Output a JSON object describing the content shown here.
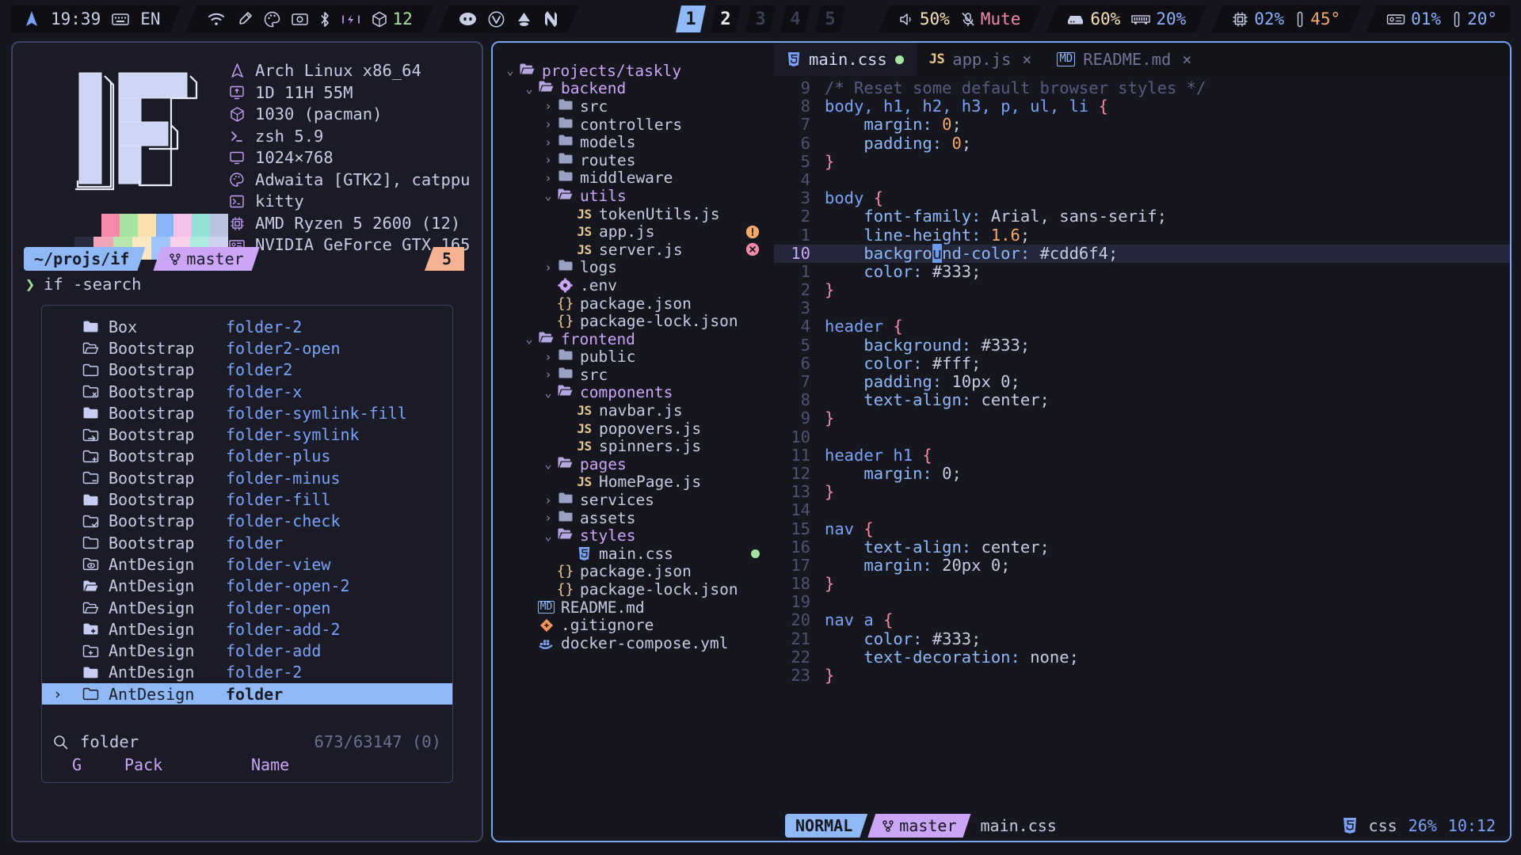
{
  "topbar": {
    "groups": [
      {
        "name": "system",
        "items": [
          {
            "icon": "arch-logo-icon",
            "text": ""
          },
          {
            "icon": "",
            "text": "19:39"
          },
          {
            "icon": "keyboard-icon",
            "text": "EN"
          }
        ]
      },
      {
        "name": "tray",
        "items": [
          {
            "icon": "wifi-icon",
            "text": ""
          },
          {
            "icon": "eyedropper-icon",
            "text": ""
          },
          {
            "icon": "palette-icon",
            "text": ""
          },
          {
            "icon": "camera-icon",
            "text": ""
          },
          {
            "icon": "bluetooth-icon",
            "text": ""
          },
          {
            "icon": "power-icon",
            "text": ""
          },
          {
            "icon": "package-icon",
            "text": "12",
            "color": "#a6e3a1"
          }
        ]
      },
      {
        "name": "apps",
        "items": [
          {
            "icon": "discord-icon",
            "text": ""
          },
          {
            "icon": "vivaldi-icon",
            "text": ""
          },
          {
            "icon": "inkscape-icon",
            "text": ""
          },
          {
            "icon": "neovim-icon",
            "text": ""
          }
        ]
      }
    ],
    "workspaces": [
      {
        "label": "1",
        "state": "active"
      },
      {
        "label": "2",
        "state": "occupied"
      },
      {
        "label": "3",
        "state": "empty"
      },
      {
        "label": "4",
        "state": "empty"
      },
      {
        "label": "5",
        "state": "empty"
      }
    ],
    "audio": {
      "volume_icon": "speaker-icon",
      "volume": "50%",
      "mic_icon": "mic-muted-icon",
      "mic_label": "Mute"
    },
    "storage": {
      "disk_icon": "disk-icon",
      "disk": "60%",
      "ram_icon": "ram-icon",
      "ram": "20%"
    },
    "cpu": {
      "cpu_icon": "cpu-icon",
      "load": "02%",
      "temp_icon": "thermometer-icon",
      "temp": "45°"
    },
    "gpu": {
      "gpu_icon": "gpu-icon",
      "load": "01%",
      "temp_icon": "thermometer-icon",
      "temp": "20°"
    }
  },
  "fetch": {
    "info": [
      {
        "icon": "arch-icon",
        "text": "Arch Linux x86_64"
      },
      {
        "icon": "uptime-icon",
        "text": "1D 11H 55M"
      },
      {
        "icon": "packages-icon",
        "text": "1030 (pacman)"
      },
      {
        "icon": "shell-icon",
        "text": "zsh 5.9"
      },
      {
        "icon": "display-icon",
        "text": "1024×768"
      },
      {
        "icon": "theme-icon",
        "text": "Adwaita [GTK2], catppu"
      },
      {
        "icon": "terminal-icon",
        "text": "kitty"
      },
      {
        "icon": "cpu-icon",
        "text": "AMD Ryzen 5 2600 (12)"
      },
      {
        "icon": "gpu-icon",
        "text": "NVIDIA GeForce GTX 165"
      }
    ],
    "palette_row1": [
      "#f38ba8",
      "#a6e3a1",
      "#f9e2af",
      "#89b4fa",
      "#f5c2e7",
      "#94e2d5",
      "#bac2de"
    ],
    "palette_row2": [
      "#f2a4b8",
      "#b9e6ae",
      "#fae8c0",
      "#9ec4fb",
      "#f8d0ec",
      "#aeeade",
      "#ccd2ee"
    ],
    "palette_dark": "#2a2b3c"
  },
  "prompt": {
    "path": "~/projs/if",
    "git_icon": "git-branch-icon",
    "git_branch": "master",
    "badge": "5",
    "chevron": "❯",
    "command": "if -search"
  },
  "fzf": {
    "query_icon": "search-icon",
    "query": "folder",
    "count": "673/63147 (0)",
    "headers": {
      "g": "G",
      "pack": "Pack",
      "name": "Name"
    },
    "rows": [
      {
        "icon": "folder-fill-icon",
        "pack": "Box",
        "name": "folder-2",
        "selected": false
      },
      {
        "icon": "folder-open-outline-icon",
        "pack": "Bootstrap",
        "name": "folder2-open",
        "selected": false
      },
      {
        "icon": "folder-outline-icon",
        "pack": "Bootstrap",
        "name": "folder2",
        "selected": false
      },
      {
        "icon": "folder-x-icon",
        "pack": "Bootstrap",
        "name": "folder-x",
        "selected": false
      },
      {
        "icon": "folder-fill-icon",
        "pack": "Bootstrap",
        "name": "folder-symlink-fill",
        "selected": false
      },
      {
        "icon": "folder-symlink-icon",
        "pack": "Bootstrap",
        "name": "folder-symlink",
        "selected": false
      },
      {
        "icon": "folder-plus-icon",
        "pack": "Bootstrap",
        "name": "folder-plus",
        "selected": false
      },
      {
        "icon": "folder-minus-icon",
        "pack": "Bootstrap",
        "name": "folder-minus",
        "selected": false
      },
      {
        "icon": "folder-fill-icon",
        "pack": "Bootstrap",
        "name": "folder-fill",
        "selected": false
      },
      {
        "icon": "folder-check-icon",
        "pack": "Bootstrap",
        "name": "folder-check",
        "selected": false
      },
      {
        "icon": "folder-outline-icon",
        "pack": "Bootstrap",
        "name": "folder",
        "selected": false
      },
      {
        "icon": "folder-view-icon",
        "pack": "AntDesign",
        "name": "folder-view",
        "selected": false
      },
      {
        "icon": "folder-open-fill-icon",
        "pack": "AntDesign",
        "name": "folder-open-2",
        "selected": false
      },
      {
        "icon": "folder-open-outline-icon",
        "pack": "AntDesign",
        "name": "folder-open",
        "selected": false
      },
      {
        "icon": "folder-add-fill-icon",
        "pack": "AntDesign",
        "name": "folder-add-2",
        "selected": false
      },
      {
        "icon": "folder-add-icon",
        "pack": "AntDesign",
        "name": "folder-add",
        "selected": false
      },
      {
        "icon": "folder-fill-icon",
        "pack": "AntDesign",
        "name": "folder-2",
        "selected": false
      },
      {
        "icon": "folder-outline-icon",
        "pack": "AntDesign",
        "name": "folder",
        "selected": true
      }
    ]
  },
  "tree": [
    {
      "depth": 0,
      "arrow": "⌄",
      "icon": "folder-open-icon",
      "label": "projects/taskly",
      "kind": "dir-open"
    },
    {
      "depth": 1,
      "arrow": "⌄",
      "icon": "folder-open-icon",
      "label": "backend",
      "kind": "dir-open"
    },
    {
      "depth": 2,
      "arrow": "›",
      "icon": "folder-icon",
      "label": "src",
      "kind": "dir"
    },
    {
      "depth": 2,
      "arrow": "›",
      "icon": "folder-icon",
      "label": "controllers",
      "kind": "dir"
    },
    {
      "depth": 2,
      "arrow": "›",
      "icon": "folder-icon",
      "label": "models",
      "kind": "dir"
    },
    {
      "depth": 2,
      "arrow": "›",
      "icon": "folder-icon",
      "label": "routes",
      "kind": "dir"
    },
    {
      "depth": 2,
      "arrow": "›",
      "icon": "folder-icon",
      "label": "middleware",
      "kind": "dir"
    },
    {
      "depth": 2,
      "arrow": "⌄",
      "icon": "folder-open-icon",
      "label": "utils",
      "kind": "dir-open"
    },
    {
      "depth": 3,
      "arrow": "",
      "icon": "js-icon",
      "label": "tokenUtils.js",
      "kind": "file"
    },
    {
      "depth": 3,
      "arrow": "",
      "icon": "js-icon",
      "label": "app.js",
      "kind": "file",
      "diag": "warning"
    },
    {
      "depth": 3,
      "arrow": "",
      "icon": "js-icon",
      "label": "server.js",
      "kind": "file",
      "diag": "error"
    },
    {
      "depth": 2,
      "arrow": "›",
      "icon": "folder-icon",
      "label": "logs",
      "kind": "dir"
    },
    {
      "depth": 2,
      "arrow": "",
      "icon": "gear-icon",
      "label": ".env",
      "kind": "file"
    },
    {
      "depth": 2,
      "arrow": "",
      "icon": "json-icon",
      "label": "package.json",
      "kind": "file"
    },
    {
      "depth": 2,
      "arrow": "",
      "icon": "json-icon",
      "label": "package-lock.json",
      "kind": "file"
    },
    {
      "depth": 1,
      "arrow": "⌄",
      "icon": "folder-open-icon",
      "label": "frontend",
      "kind": "dir-open"
    },
    {
      "depth": 2,
      "arrow": "›",
      "icon": "folder-icon",
      "label": "public",
      "kind": "dir"
    },
    {
      "depth": 2,
      "arrow": "›",
      "icon": "folder-icon",
      "label": "src",
      "kind": "dir"
    },
    {
      "depth": 2,
      "arrow": "⌄",
      "icon": "folder-open-icon",
      "label": "components",
      "kind": "dir-open"
    },
    {
      "depth": 3,
      "arrow": "",
      "icon": "js-icon",
      "label": "navbar.js",
      "kind": "file"
    },
    {
      "depth": 3,
      "arrow": "",
      "icon": "js-icon",
      "label": "popovers.js",
      "kind": "file"
    },
    {
      "depth": 3,
      "arrow": "",
      "icon": "js-icon",
      "label": "spinners.js",
      "kind": "file"
    },
    {
      "depth": 2,
      "arrow": "⌄",
      "icon": "folder-open-icon",
      "label": "pages",
      "kind": "dir-open"
    },
    {
      "depth": 3,
      "arrow": "",
      "icon": "js-icon",
      "label": "HomePage.js",
      "kind": "file"
    },
    {
      "depth": 2,
      "arrow": "›",
      "icon": "folder-icon",
      "label": "services",
      "kind": "dir"
    },
    {
      "depth": 2,
      "arrow": "›",
      "icon": "folder-icon",
      "label": "assets",
      "kind": "dir"
    },
    {
      "depth": 2,
      "arrow": "⌄",
      "icon": "folder-open-icon",
      "label": "styles",
      "kind": "dir-open"
    },
    {
      "depth": 3,
      "arrow": "",
      "icon": "css-icon",
      "label": "main.css",
      "kind": "file",
      "diag": "modified"
    },
    {
      "depth": 2,
      "arrow": "",
      "icon": "json-icon",
      "label": "package.json",
      "kind": "file"
    },
    {
      "depth": 2,
      "arrow": "",
      "icon": "json-icon",
      "label": "package-lock.json",
      "kind": "file"
    },
    {
      "depth": 1,
      "arrow": "",
      "icon": "md-icon",
      "label": "README.md",
      "kind": "file"
    },
    {
      "depth": 1,
      "arrow": "",
      "icon": "git-icon",
      "label": ".gitignore",
      "kind": "file"
    },
    {
      "depth": 1,
      "arrow": "",
      "icon": "docker-icon",
      "label": "docker-compose.yml",
      "kind": "file"
    }
  ],
  "tabs": [
    {
      "icon": "css-icon",
      "label": "main.css",
      "active": true,
      "modified": true,
      "closable": false
    },
    {
      "icon": "js-icon",
      "label": "app.js",
      "active": false,
      "modified": false,
      "closable": true
    },
    {
      "icon": "md-icon",
      "label": "README.md",
      "active": false,
      "modified": false,
      "closable": true
    }
  ],
  "code": {
    "lines": [
      {
        "num": "9",
        "cur": false,
        "tokens": [
          {
            "t": "/* Reset some default browser styles */",
            "c": "k-com"
          }
        ]
      },
      {
        "num": "8",
        "cur": false,
        "tokens": [
          {
            "t": "body, h1, h2, h3, p, ul, li ",
            "c": "k-sel"
          },
          {
            "t": "{",
            "c": "k-brace"
          }
        ]
      },
      {
        "num": "7",
        "cur": false,
        "tokens": [
          {
            "t": "    ",
            "c": "k-guide"
          },
          {
            "t": "margin: ",
            "c": "k-prop"
          },
          {
            "t": "0",
            "c": "k-num"
          },
          {
            "t": ";",
            "c": "k-val"
          }
        ]
      },
      {
        "num": "6",
        "cur": false,
        "tokens": [
          {
            "t": "    ",
            "c": "k-guide"
          },
          {
            "t": "padding: ",
            "c": "k-prop"
          },
          {
            "t": "0",
            "c": "k-num"
          },
          {
            "t": ";",
            "c": "k-val"
          }
        ]
      },
      {
        "num": "5",
        "cur": false,
        "tokens": [
          {
            "t": "}",
            "c": "k-brace"
          }
        ]
      },
      {
        "num": "4",
        "cur": false,
        "tokens": []
      },
      {
        "num": "3",
        "cur": false,
        "tokens": [
          {
            "t": "body ",
            "c": "k-sel"
          },
          {
            "t": "{",
            "c": "k-brace"
          }
        ]
      },
      {
        "num": "2",
        "cur": false,
        "tokens": [
          {
            "t": "    ",
            "c": "k-guide"
          },
          {
            "t": "font-family: ",
            "c": "k-prop"
          },
          {
            "t": "Arial, sans-serif;",
            "c": "k-val"
          }
        ]
      },
      {
        "num": "1",
        "cur": false,
        "tokens": [
          {
            "t": "    ",
            "c": "k-guide"
          },
          {
            "t": "line-height: ",
            "c": "k-prop"
          },
          {
            "t": "1.6",
            "c": "k-num"
          },
          {
            "t": ";",
            "c": "k-val"
          }
        ]
      },
      {
        "num": "10",
        "cur": true,
        "tokens": [
          {
            "t": "    ",
            "c": "k-guide"
          },
          {
            "t": "backgro",
            "c": "k-prop"
          },
          {
            "t": "u",
            "c": "cursor-box"
          },
          {
            "t": "nd-color: ",
            "c": "k-prop"
          },
          {
            "t": "#cdd6f4;",
            "c": "k-val"
          }
        ]
      },
      {
        "num": "1",
        "cur": false,
        "tokens": [
          {
            "t": "    ",
            "c": "k-guide"
          },
          {
            "t": "color: ",
            "c": "k-prop"
          },
          {
            "t": "#333;",
            "c": "k-val"
          }
        ]
      },
      {
        "num": "2",
        "cur": false,
        "tokens": [
          {
            "t": "}",
            "c": "k-brace"
          }
        ]
      },
      {
        "num": "3",
        "cur": false,
        "tokens": []
      },
      {
        "num": "4",
        "cur": false,
        "tokens": [
          {
            "t": "header ",
            "c": "k-sel"
          },
          {
            "t": "{",
            "c": "k-brace"
          }
        ]
      },
      {
        "num": "5",
        "cur": false,
        "tokens": [
          {
            "t": "    ",
            "c": "k-guide"
          },
          {
            "t": "background: ",
            "c": "k-prop"
          },
          {
            "t": "#333;",
            "c": "k-val"
          }
        ]
      },
      {
        "num": "6",
        "cur": false,
        "tokens": [
          {
            "t": "    ",
            "c": "k-guide"
          },
          {
            "t": "color: ",
            "c": "k-prop"
          },
          {
            "t": "#fff;",
            "c": "k-val"
          }
        ]
      },
      {
        "num": "7",
        "cur": false,
        "tokens": [
          {
            "t": "    ",
            "c": "k-guide"
          },
          {
            "t": "padding: ",
            "c": "k-prop"
          },
          {
            "t": "10px 0;",
            "c": "k-val"
          }
        ]
      },
      {
        "num": "8",
        "cur": false,
        "tokens": [
          {
            "t": "    ",
            "c": "k-guide"
          },
          {
            "t": "text-align: ",
            "c": "k-prop"
          },
          {
            "t": "center;",
            "c": "k-val"
          }
        ]
      },
      {
        "num": "9",
        "cur": false,
        "tokens": [
          {
            "t": "}",
            "c": "k-brace"
          }
        ]
      },
      {
        "num": "10",
        "cur": false,
        "tokens": []
      },
      {
        "num": "11",
        "cur": false,
        "tokens": [
          {
            "t": "header h1 ",
            "c": "k-sel"
          },
          {
            "t": "{",
            "c": "k-brace"
          }
        ]
      },
      {
        "num": "12",
        "cur": false,
        "tokens": [
          {
            "t": "    ",
            "c": "k-guide"
          },
          {
            "t": "margin: ",
            "c": "k-prop"
          },
          {
            "t": "0;",
            "c": "k-val"
          }
        ]
      },
      {
        "num": "13",
        "cur": false,
        "tokens": [
          {
            "t": "}",
            "c": "k-brace"
          }
        ]
      },
      {
        "num": "14",
        "cur": false,
        "tokens": []
      },
      {
        "num": "15",
        "cur": false,
        "tokens": [
          {
            "t": "nav ",
            "c": "k-sel"
          },
          {
            "t": "{",
            "c": "k-brace"
          }
        ]
      },
      {
        "num": "16",
        "cur": false,
        "tokens": [
          {
            "t": "    ",
            "c": "k-guide"
          },
          {
            "t": "text-align: ",
            "c": "k-prop"
          },
          {
            "t": "center;",
            "c": "k-val"
          }
        ]
      },
      {
        "num": "17",
        "cur": false,
        "tokens": [
          {
            "t": "    ",
            "c": "k-guide"
          },
          {
            "t": "margin: ",
            "c": "k-prop"
          },
          {
            "t": "20px 0;",
            "c": "k-val"
          }
        ]
      },
      {
        "num": "18",
        "cur": false,
        "tokens": [
          {
            "t": "}",
            "c": "k-brace"
          }
        ]
      },
      {
        "num": "19",
        "cur": false,
        "tokens": []
      },
      {
        "num": "20",
        "cur": false,
        "tokens": [
          {
            "t": "nav a ",
            "c": "k-sel"
          },
          {
            "t": "{",
            "c": "k-brace"
          }
        ]
      },
      {
        "num": "21",
        "cur": false,
        "tokens": [
          {
            "t": "    ",
            "c": "k-guide"
          },
          {
            "t": "color: ",
            "c": "k-prop"
          },
          {
            "t": "#333;",
            "c": "k-val"
          }
        ]
      },
      {
        "num": "22",
        "cur": false,
        "tokens": [
          {
            "t": "    ",
            "c": "k-guide"
          },
          {
            "t": "text-decoration: ",
            "c": "k-prop"
          },
          {
            "t": "none;",
            "c": "k-val"
          }
        ]
      },
      {
        "num": "23",
        "cur": false,
        "tokens": [
          {
            "t": "}",
            "c": "k-brace"
          }
        ]
      }
    ]
  },
  "statusline": {
    "mode": "NORMAL",
    "git_icon": "git-branch-icon",
    "git_branch": "master",
    "filename": "main.css",
    "filetype_icon": "css-icon",
    "filetype": "css",
    "percent": "26%",
    "position": "10:12"
  }
}
